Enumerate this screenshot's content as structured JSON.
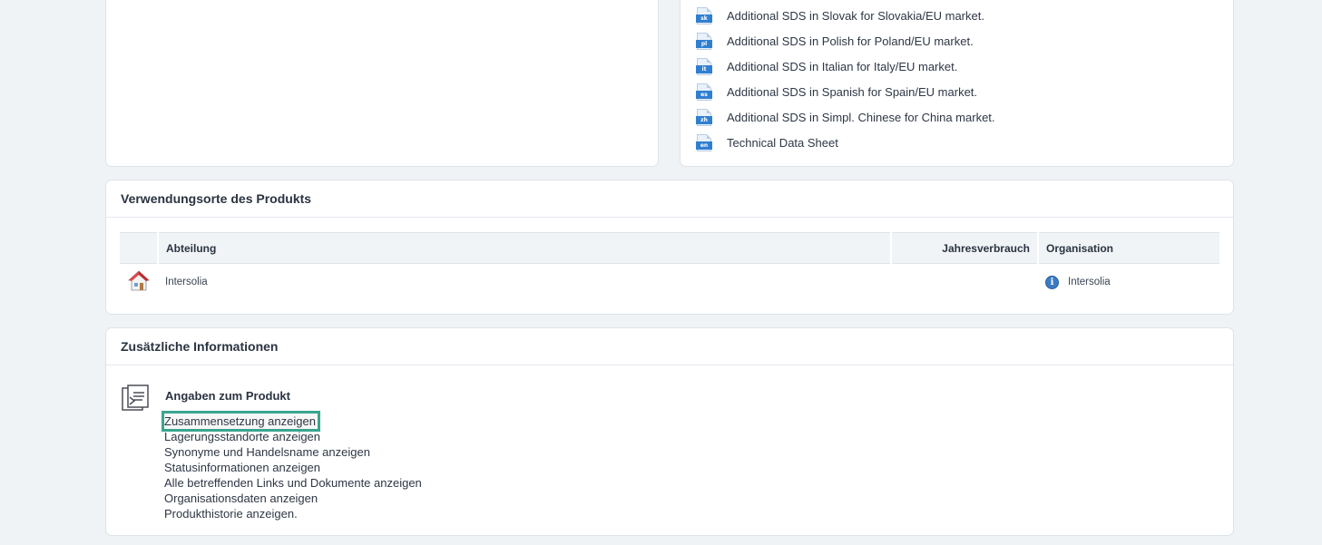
{
  "documents": [
    {
      "lang": "sk",
      "label": "Additional SDS in Slovak for Slovakia/EU market."
    },
    {
      "lang": "pl",
      "label": "Additional SDS in Polish for Poland/EU market."
    },
    {
      "lang": "it",
      "label": "Additional SDS in Italian for Italy/EU market."
    },
    {
      "lang": "es",
      "label": "Additional SDS in Spanish for Spain/EU market."
    },
    {
      "lang": "zh",
      "label": "Additional SDS in Simpl. Chinese for China market."
    },
    {
      "lang": "en",
      "label": "Technical Data Sheet"
    }
  ],
  "usage": {
    "title": "Verwendungsorte des Produkts",
    "columns": {
      "department": "Abteilung",
      "annual": "Jahresverbrauch",
      "organisation": "Organisation"
    },
    "rows": [
      {
        "department": "Intersolia",
        "annual": "",
        "organisation": "Intersolia",
        "icon": "house-icon"
      }
    ]
  },
  "info": {
    "title": "Zusätzliche Informationen",
    "section_title": "Angaben zum Produkt",
    "icon": "product-sheet-icon",
    "links": [
      "Zusammensetzung anzeigen",
      "Lagerungsstandorte anzeigen",
      "Synonyme und Handelsname anzeigen",
      "Statusinformationen anzeigen",
      "Alle betreffenden Links und Dokumente anzeigen",
      "Organisationsdaten anzeigen",
      "Produkthistorie anzeigen."
    ]
  },
  "colors": {
    "background": "#eff3f6",
    "accent_blue": "#2f7fd1",
    "highlight": "#3aa68f"
  }
}
